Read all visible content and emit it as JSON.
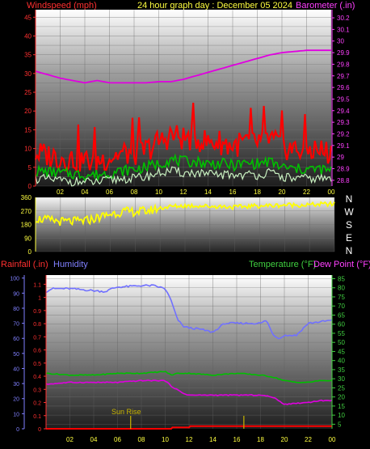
{
  "header": {
    "windspeed_label": "Windspeed (mph)",
    "title": "24 hour graph day : December 05 2024",
    "barometer_label": "Barometer (.in)"
  },
  "lower_header": {
    "rainfall_label": "Rainfall (.in)",
    "humidity_label": "Humidity",
    "temperature_label": "Temperature (°F)",
    "dewpoint_label": "Dew Point (°F)"
  },
  "compass_labels": [
    "N",
    "W",
    "S",
    "E",
    "N"
  ],
  "colors": {
    "wind_gust": "#ff0000",
    "wind_avg": "#00c000",
    "wind_low": "#c8f0c0",
    "barometer": "#e000e0",
    "direction": "#ffff00",
    "humidity": "#7070ff",
    "temperature": "#00c000",
    "dewpoint": "#e000e0",
    "rainfall": "#ff0000",
    "sun_markers": "#c8b400",
    "windspeed_axis": "#ff3030",
    "barometer_axis": "#ff40ff",
    "title_text": "#ffff40"
  },
  "sun_rise_label": "Sun Rise",
  "chart_data": [
    {
      "type": "line",
      "name": "wind-barometer",
      "x_ticks": [
        "02",
        "04",
        "06",
        "08",
        "10",
        "12",
        "14",
        "16",
        "18",
        "20",
        "22",
        "00"
      ],
      "y_left_ticks": [
        0,
        5,
        10,
        15,
        20,
        25,
        30,
        35,
        40,
        45
      ],
      "y_left_range": [
        0,
        47
      ],
      "y_right_ticks": [
        28.8,
        28.9,
        29,
        29.1,
        29.2,
        29.3,
        29.4,
        29.5,
        29.6,
        29.7,
        29.8,
        29.9,
        30,
        30.1,
        30.2
      ],
      "y_right_range": [
        28.75,
        30.27
      ],
      "series": [
        {
          "axis": "left",
          "hours": [
            0,
            2,
            4,
            5,
            6,
            7,
            8,
            9,
            10,
            11,
            12,
            13,
            14,
            15,
            16,
            17,
            18,
            19,
            20,
            21,
            22,
            23,
            24
          ],
          "values": [
            8,
            7,
            6,
            6,
            7,
            8,
            8,
            9,
            11,
            13,
            12,
            12,
            11,
            11,
            10,
            11,
            11,
            12,
            10,
            9,
            9,
            9,
            8
          ]
        },
        {
          "axis": "left",
          "hours": [
            0,
            2,
            4,
            5,
            6,
            7,
            8,
            9,
            10,
            11,
            12,
            13,
            14,
            15,
            16,
            17,
            18,
            19,
            20,
            21,
            22,
            23,
            24
          ],
          "values": [
            4,
            3.5,
            3,
            3,
            3.5,
            4,
            4.5,
            5,
            6,
            7,
            6.5,
            6.5,
            6,
            6,
            5.5,
            6,
            6,
            6.5,
            5,
            4.5,
            4.5,
            4.5,
            4
          ]
        },
        {
          "axis": "left",
          "hours": [
            0,
            2,
            4,
            5,
            6,
            7,
            8,
            9,
            10,
            11,
            12,
            13,
            14,
            15,
            16,
            17,
            18,
            19,
            20,
            21,
            22,
            23,
            24
          ],
          "values": [
            2,
            1.5,
            1,
            1,
            1.5,
            2,
            2,
            2.5,
            3.5,
            4,
            3.5,
            3.5,
            3,
            3,
            3,
            3,
            3,
            3.5,
            2.5,
            2,
            2,
            2,
            2
          ]
        },
        {
          "axis": "right",
          "hours": [
            0,
            2,
            4,
            5,
            6,
            7,
            8,
            9,
            10,
            11,
            12,
            13,
            14,
            15,
            16,
            17,
            18,
            19,
            20,
            21,
            22,
            23,
            24
          ],
          "values": [
            29.74,
            29.68,
            29.64,
            29.66,
            29.64,
            29.64,
            29.64,
            29.64,
            29.65,
            29.65,
            29.67,
            29.7,
            29.73,
            29.76,
            29.79,
            29.82,
            29.85,
            29.88,
            29.9,
            29.91,
            29.92,
            29.92,
            29.92
          ]
        }
      ]
    },
    {
      "type": "line",
      "name": "wind-direction",
      "x_ticks": [
        "02",
        "04",
        "06",
        "08",
        "10",
        "12",
        "14",
        "16",
        "18",
        "20",
        "22",
        "00"
      ],
      "y_ticks": [
        0,
        90,
        180,
        270,
        360
      ],
      "y_range": [
        0,
        360
      ],
      "series": [
        {
          "hours": [
            0,
            1,
            2,
            3,
            4,
            5,
            6,
            7,
            8,
            9,
            10,
            11,
            12,
            13,
            14,
            15,
            16,
            17,
            18,
            19,
            20,
            21,
            22,
            23,
            24
          ],
          "values": [
            220,
            210,
            200,
            200,
            205,
            225,
            250,
            265,
            265,
            270,
            290,
            300,
            305,
            305,
            300,
            300,
            295,
            300,
            305,
            305,
            310,
            310,
            310,
            315,
            315
          ]
        }
      ]
    },
    {
      "type": "line",
      "name": "rain-humidity-temperature",
      "x_ticks": [
        "02",
        "04",
        "06",
        "08",
        "10",
        "12",
        "14",
        "16",
        "18",
        "20",
        "22",
        "00"
      ],
      "y_rain_ticks": [
        0,
        0.1,
        0.2,
        0.3,
        0.4,
        0.5,
        0.6,
        0.7,
        0.8,
        0.9,
        1,
        1.1
      ],
      "y_rain_range": [
        0,
        1.17
      ],
      "y_humidity_ticks": [
        0,
        10,
        20,
        30,
        40,
        50,
        60,
        70,
        80,
        90,
        100
      ],
      "y_humidity_range": [
        0,
        102
      ],
      "y_temp_ticks": [
        5,
        10,
        15,
        20,
        25,
        30,
        35,
        40,
        45,
        50,
        55,
        60,
        65,
        70,
        75,
        80,
        85
      ],
      "y_temp_range": [
        2.5,
        87
      ],
      "sun_rise_hour": 7.1,
      "sun_set_hour": 16.6,
      "series": [
        {
          "axis": "humidity",
          "hours": [
            0,
            0.5,
            2,
            5,
            5.5,
            6,
            8,
            9,
            10,
            10.5,
            11,
            11.5,
            12,
            13,
            14,
            15,
            17,
            18,
            18.5,
            19,
            19.5,
            20,
            21,
            22,
            23,
            24
          ],
          "values": [
            91,
            93,
            93,
            91,
            93,
            94,
            95,
            95,
            93,
            85,
            73,
            68,
            67,
            66,
            64,
            70,
            70,
            70,
            72,
            63,
            60,
            62,
            62,
            70,
            71,
            72
          ]
        },
        {
          "axis": "temp",
          "hours": [
            0,
            2,
            4,
            6,
            8,
            10,
            10.5,
            11,
            12,
            14,
            16,
            18,
            19,
            20,
            21,
            22,
            23,
            24
          ],
          "values": [
            33,
            32,
            32,
            33,
            33,
            34,
            32,
            33,
            33,
            32,
            33,
            32,
            31,
            29,
            28,
            28,
            29,
            29
          ]
        },
        {
          "axis": "temp",
          "hours": [
            0,
            2,
            4,
            6,
            8,
            10,
            10.5,
            11,
            11.5,
            12,
            14,
            16,
            18,
            19,
            19.5,
            20,
            22,
            23,
            24
          ],
          "values": [
            27,
            28,
            28,
            28,
            29,
            29,
            26,
            24,
            22,
            21,
            21,
            21,
            21,
            20,
            18,
            16,
            17,
            18,
            18
          ]
        },
        {
          "axis": "rain",
          "hours": [
            0,
            10.5,
            10.6,
            12,
            12.1,
            24
          ],
          "values": [
            0,
            0,
            0.01,
            0.01,
            0.02,
            0.02
          ]
        }
      ]
    }
  ]
}
